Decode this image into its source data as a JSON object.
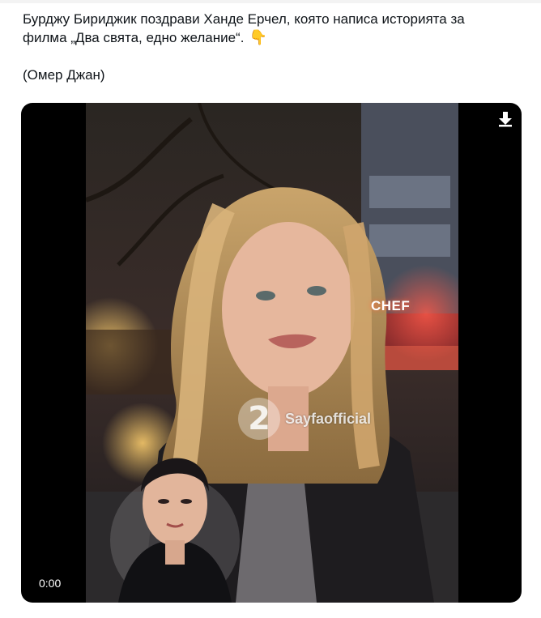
{
  "post": {
    "text_line1": "Бурджу Бириджик поздрави Ханде Ерчел, която написа историята за",
    "text_line2": "филма „Два свята, едно желание“.",
    "emoji": "👇",
    "byline": "(Омер Джан)"
  },
  "video": {
    "time": "0:00",
    "watermark_logo": "2",
    "watermark_text": "Sayfaofficial",
    "background_sign": "CHEF",
    "download_icon": "download-icon"
  }
}
